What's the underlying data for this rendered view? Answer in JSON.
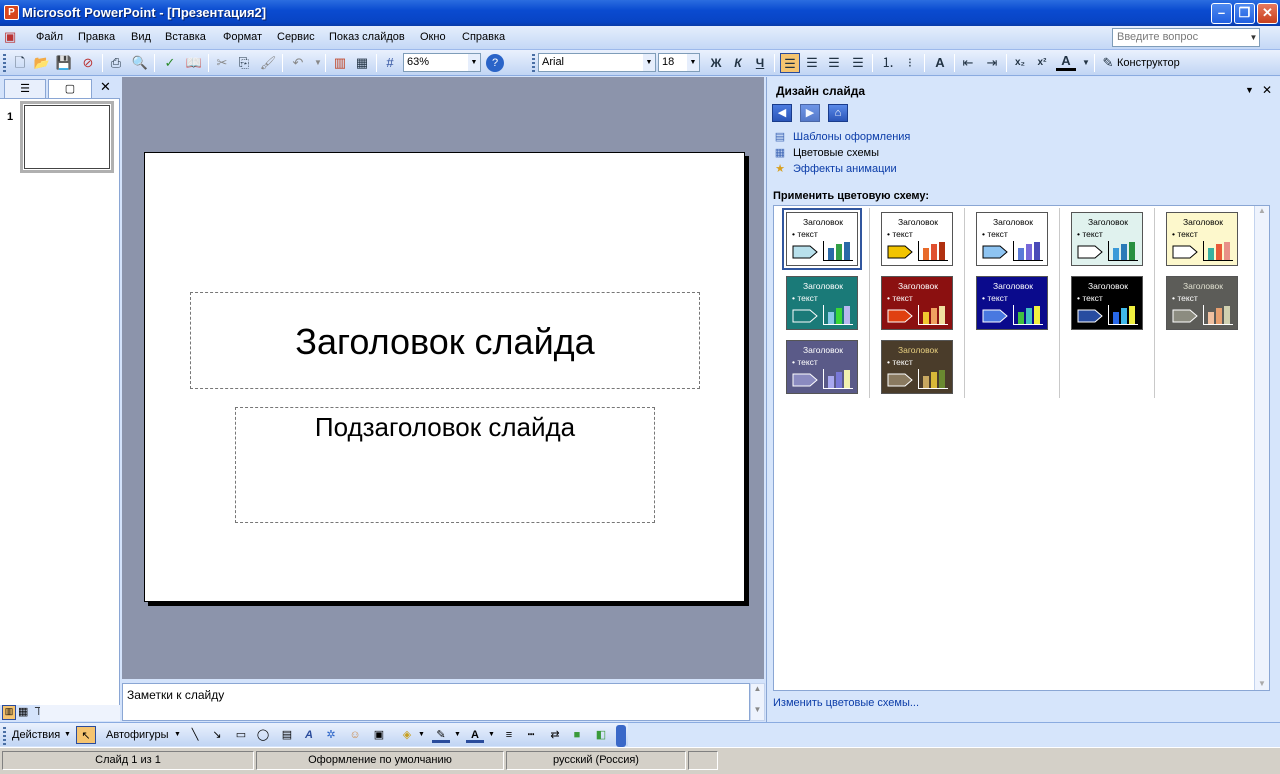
{
  "window": {
    "title": "Microsoft PowerPoint - [Презентация2]"
  },
  "menu": {
    "items": [
      "Файл",
      "Правка",
      "Вид",
      "Вставка",
      "Формат",
      "Сервис",
      "Показ слайдов",
      "Окно",
      "Справка"
    ],
    "help_placeholder": "Введите вопрос"
  },
  "toolbar": {
    "zoom": "63%",
    "font": "Arial",
    "size": "18",
    "bold": "Ж",
    "italic": "К",
    "underline": "Ч",
    "designer": "Конструктор"
  },
  "slides_pane": {
    "slide_number": "1"
  },
  "slide": {
    "title": "Заголовок слайда",
    "subtitle": "Подзаголовок слайда"
  },
  "notes": {
    "placeholder": "Заметки к слайду"
  },
  "task_pane": {
    "title": "Дизайн слайда",
    "links": [
      {
        "label": "Шаблоны оформления",
        "icon": "templates-icon"
      },
      {
        "label": "Цветовые схемы",
        "icon": "color-schemes-icon"
      },
      {
        "label": "Эффекты анимации",
        "icon": "animation-effects-icon"
      }
    ],
    "apply_label": "Применить цветовую схему:",
    "scheme_title": "Заголовок",
    "scheme_text": "• текст",
    "change_link": "Изменить цветовые схемы...",
    "schemes": [
      {
        "bg": "#ffffff",
        "title": "#000000",
        "text": "#000000",
        "shape": "#b8e0ec",
        "bars": [
          "#2a6aa8",
          "#33a047",
          "#2a6aa8"
        ]
      },
      {
        "bg": "#ffffff",
        "title": "#000000",
        "text": "#000000",
        "shape": "#f2c400",
        "bars": [
          "#e86a2a",
          "#e05030",
          "#b03010"
        ]
      },
      {
        "bg": "#ffffff",
        "title": "#000000",
        "text": "#000000",
        "shape": "#8ec4f2",
        "bars": [
          "#5a7ad8",
          "#7868d8",
          "#4a4ab8"
        ]
      },
      {
        "bg": "#e0f2ee",
        "title": "#000000",
        "text": "#000000",
        "shape": "#ffffff",
        "bars": [
          "#3a9ad8",
          "#2a7ab8",
          "#289040"
        ]
      },
      {
        "bg": "#fdf8cc",
        "title": "#000000",
        "text": "#000000",
        "shape": "#ffffff",
        "bars": [
          "#38b0a0",
          "#e85a38",
          "#e89088"
        ]
      },
      {
        "bg": "#1a7a78",
        "title": "#ffffff",
        "text": "#ffffff",
        "shape": "#1a7a78",
        "bars": [
          "#88c8e8",
          "#3ad838",
          "#b8b8f0"
        ]
      },
      {
        "bg": "#8b1010",
        "title": "#ffffff",
        "text": "#ffffff",
        "shape": "#e04010",
        "bars": [
          "#f0c830",
          "#f0a060",
          "#f0e0a0"
        ]
      },
      {
        "bg": "#0a0a8c",
        "title": "#ffffff",
        "text": "#ffffff",
        "shape": "#4878e0",
        "bars": [
          "#40c040",
          "#40c0c0",
          "#f0f040"
        ]
      },
      {
        "bg": "#000000",
        "title": "#ffffff",
        "text": "#ffffff",
        "shape": "#284ca0",
        "bars": [
          "#2868e8",
          "#40b8e8",
          "#f0f040"
        ]
      },
      {
        "bg": "#5c5c58",
        "title": "#e0e0d0",
        "text": "#ffffff",
        "shape": "#8c8c80",
        "bars": [
          "#f0c0a0",
          "#e8a070",
          "#d0d0b0"
        ]
      },
      {
        "bg": "#5a5a88",
        "title": "#ffffff",
        "text": "#ffffff",
        "shape": "#8a8ac0",
        "bars": [
          "#a8a8f0",
          "#7878d8",
          "#f0f0b0"
        ]
      },
      {
        "bg": "#4a3c2a",
        "title": "#e8d080",
        "text": "#ffffff",
        "shape": "#8a7a60",
        "bars": [
          "#c8a860",
          "#d8b838",
          "#6a8a30"
        ]
      }
    ]
  },
  "drawing": {
    "actions": "Действия",
    "autoshapes": "Автофигуры"
  },
  "status": {
    "slide": "Слайд 1 из 1",
    "design": "Оформление по умолчанию",
    "language": "русский (Россия)"
  }
}
